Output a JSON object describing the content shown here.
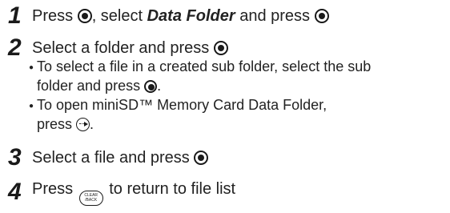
{
  "steps": [
    {
      "number": "1",
      "pre": "Press ",
      "mid1": ", select ",
      "emph": "Data Folder",
      "mid2": " and press ",
      "post": ""
    },
    {
      "number": "2",
      "text": "Select a folder and press "
    },
    {
      "number": "3",
      "text": "Select a file and press "
    },
    {
      "number": "4",
      "pre": "Press ",
      "post": " to return to file list"
    }
  ],
  "bullets": [
    {
      "dot": "●",
      "line1": "To select a file in a created sub folder, select the sub",
      "line2": "folder and press ",
      "line2_end": "."
    },
    {
      "dot": "●",
      "line1": "To open miniSD™ Memory Card Data Folder,",
      "line2": "press ",
      "line2_end": "."
    }
  ],
  "icons": {
    "select": "center-select-key-icon",
    "menu": "menu-arrow-key-icon",
    "clear": "clear-back-key-icon",
    "clear_label_top": "CLEAR",
    "clear_label_bottom": "/BACK"
  }
}
